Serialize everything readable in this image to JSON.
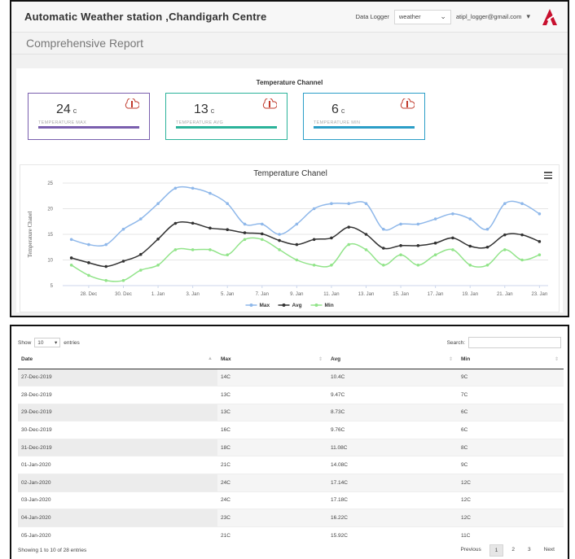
{
  "header": {
    "title": "Automatic Weather station ,Chandigarh Centre",
    "data_logger_label": "Data Logger",
    "data_logger_value": "weather",
    "user_email": "atipl_logger@gmail.com"
  },
  "report_title": "Comprehensive Report",
  "section_title": "Temperature Channel",
  "cards": [
    {
      "value": "24",
      "unit": "c",
      "label": "TEMPERATURE MAX",
      "color": "#7a5fae"
    },
    {
      "value": "13",
      "unit": "c",
      "label": "TEMPERATURE AVG",
      "color": "#2bb39a"
    },
    {
      "value": "6",
      "unit": "c",
      "label": "TEMPERATURE MIN",
      "color": "#2b9ec7"
    }
  ],
  "chart_data": {
    "type": "line",
    "title": "Temperature Chanel",
    "ylabel": "Temperature Chanel",
    "xlabel": "",
    "ylim": [
      5,
      25
    ],
    "yticks": [
      5,
      10,
      15,
      20,
      25
    ],
    "x_tick_labels": [
      "28. Dec",
      "30. Dec",
      "1. Jan",
      "3. Jan",
      "5. Jan",
      "7. Jan",
      "9. Jan",
      "11. Jan",
      "13. Jan",
      "15. Jan",
      "17. Jan",
      "19. Jan",
      "21. Jan",
      "23. Jan"
    ],
    "grid": true,
    "legend_position": "bottom-center",
    "series": [
      {
        "name": "Max",
        "color": "#8fb8ea",
        "values": [
          14,
          13,
          13,
          16,
          18,
          21,
          24,
          24,
          23,
          21,
          17,
          17,
          15,
          17,
          20,
          21,
          21,
          21,
          16,
          17,
          17,
          18,
          19,
          18,
          16,
          21,
          21,
          19
        ]
      },
      {
        "name": "Avg",
        "color": "#333333",
        "values": [
          10.4,
          9.47,
          8.73,
          9.76,
          11.08,
          14.08,
          17.14,
          17.18,
          16.22,
          15.92,
          15.3,
          15.1,
          13.8,
          13.0,
          14.0,
          14.3,
          16.4,
          15.0,
          12.3,
          12.8,
          12.8,
          13.3,
          14.3,
          12.7,
          12.5,
          14.9,
          14.9,
          13.6
        ]
      },
      {
        "name": "Min",
        "color": "#92e48a",
        "values": [
          9,
          7,
          6,
          6,
          8,
          9,
          12,
          12,
          12,
          11,
          14,
          14,
          12,
          10,
          9,
          9,
          13,
          12,
          9,
          11,
          9,
          11,
          12,
          9,
          9,
          12,
          10,
          11
        ]
      }
    ]
  },
  "table": {
    "show_label": "Show",
    "page_length": "10",
    "entries_label": "entries",
    "search_label": "Search:",
    "columns": [
      "Date",
      "Max",
      "Avg",
      "Min"
    ],
    "rows": [
      [
        "27-Dec-2019",
        "14C",
        "10.4C",
        "9C"
      ],
      [
        "28-Dec-2019",
        "13C",
        "9.47C",
        "7C"
      ],
      [
        "29-Dec-2019",
        "13C",
        "8.73C",
        "6C"
      ],
      [
        "30-Dec-2019",
        "16C",
        "9.76C",
        "6C"
      ],
      [
        "31-Dec-2019",
        "18C",
        "11.08C",
        "8C"
      ],
      [
        "01-Jan-2020",
        "21C",
        "14.08C",
        "9C"
      ],
      [
        "02-Jan-2020",
        "24C",
        "17.14C",
        "12C"
      ],
      [
        "03-Jan-2020",
        "24C",
        "17.18C",
        "12C"
      ],
      [
        "04-Jan-2020",
        "23C",
        "16.22C",
        "12C"
      ],
      [
        "05-Jan-2020",
        "21C",
        "15.92C",
        "11C"
      ]
    ],
    "info": "Showing 1 to 10 of 28 entries",
    "pagination": [
      "Previous",
      "1",
      "2",
      "3",
      "Next"
    ]
  }
}
